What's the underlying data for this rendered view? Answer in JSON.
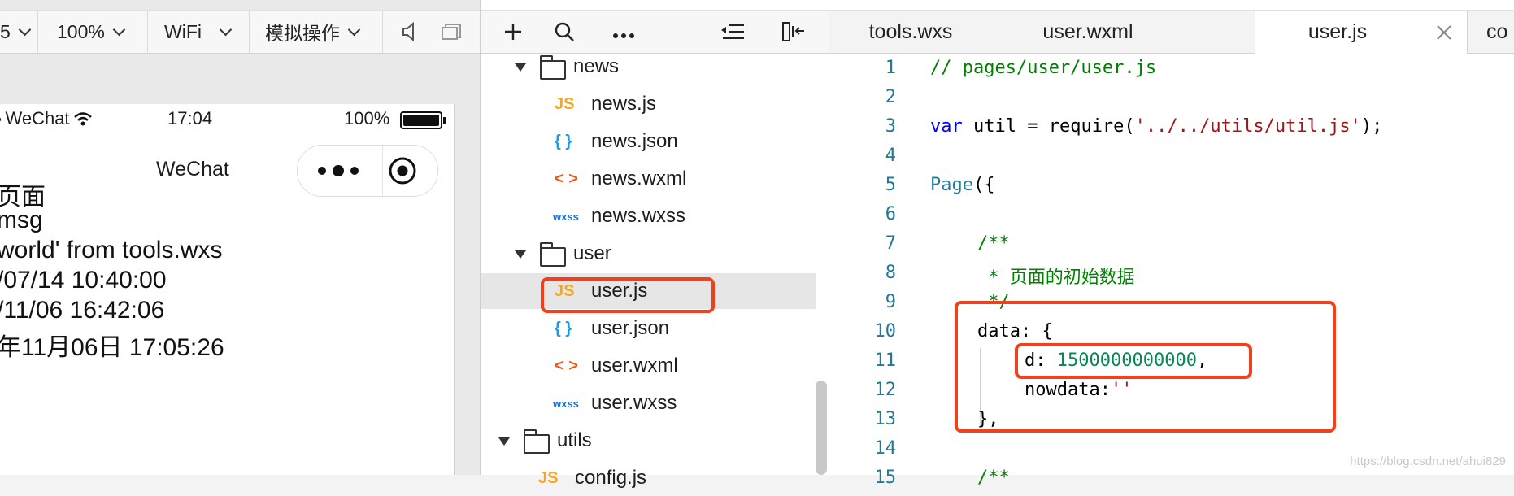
{
  "simulator": {
    "toolbar": {
      "device_partial": "5",
      "zoom": "100%",
      "network": "WiFi",
      "simulate": "模拟操作"
    },
    "status_bar": {
      "carrier": "WeChat",
      "time": "17:04",
      "battery": "100%"
    },
    "nav_title": "WeChat",
    "page_lines": [
      "页面",
      " msg",
      " world' from tools.wxs",
      "/07/14 10:40:00",
      "/11/06 16:42:06",
      "年11月06日 17:05:26"
    ]
  },
  "file_tree": {
    "rows": [
      {
        "type": "folder",
        "name": "news",
        "icon": "folder-icon"
      },
      {
        "type": "file",
        "name": "news.js",
        "icon_text": "JS",
        "icon_color": "#f5a623"
      },
      {
        "type": "file",
        "name": "news.json",
        "icon_text": "{ }",
        "icon_color": "#1a9be6"
      },
      {
        "type": "file",
        "name": "news.wxml",
        "icon_text": "< >",
        "icon_color": "#f0581c"
      },
      {
        "type": "file",
        "name": "news.wxss",
        "icon_text": "wxss",
        "icon_color": "#1a6fd6"
      },
      {
        "type": "folder",
        "name": "user",
        "icon": "folder-icon"
      },
      {
        "type": "file",
        "name": "user.js",
        "icon_text": "JS",
        "icon_color": "#f5a623",
        "selected": true
      },
      {
        "type": "file",
        "name": "user.json",
        "icon_text": "{ }",
        "icon_color": "#1a9be6"
      },
      {
        "type": "file",
        "name": "user.wxml",
        "icon_text": "< >",
        "icon_color": "#f0581c"
      },
      {
        "type": "file",
        "name": "user.wxss",
        "icon_text": "wxss",
        "icon_color": "#1a6fd6"
      },
      {
        "type": "folder",
        "name": "utils",
        "icon": "folder-icon"
      },
      {
        "type": "file",
        "name": "config.js",
        "icon_text": "JS",
        "icon_color": "#f5a623"
      }
    ]
  },
  "editor": {
    "tabs": [
      {
        "label": "tools.wxs",
        "active": false
      },
      {
        "label": "user.wxml",
        "active": false
      },
      {
        "label": "user.js",
        "active": true
      },
      {
        "label": "co",
        "active": false
      }
    ],
    "line_numbers": [
      "1",
      "2",
      "3",
      "4",
      "5",
      "6",
      "7",
      "8",
      "9",
      "10",
      "11",
      "12",
      "13",
      "14",
      "15"
    ],
    "code": {
      "l1": "// pages/user/user.js",
      "l3_kw": "var",
      "l3_mid": " util = require(",
      "l3_str": "'../../utils/util.js'",
      "l3_end": ");",
      "l5_fn": "Page",
      "l5_end": "({",
      "l7": "/**",
      "l8": " * 页面的初始数据",
      "l9": " */",
      "l10": "data: {",
      "l11_key": "d: ",
      "l11_num": "1500000000000",
      "l11_end": ",",
      "l12_key": "nowdata:",
      "l12_str": "''",
      "l13": "},",
      "l15": "/**"
    }
  },
  "watermark": "https://blog.csdn.net/ahui829",
  "colors": {
    "highlight": "#f0401c",
    "line_number": "#237893"
  }
}
